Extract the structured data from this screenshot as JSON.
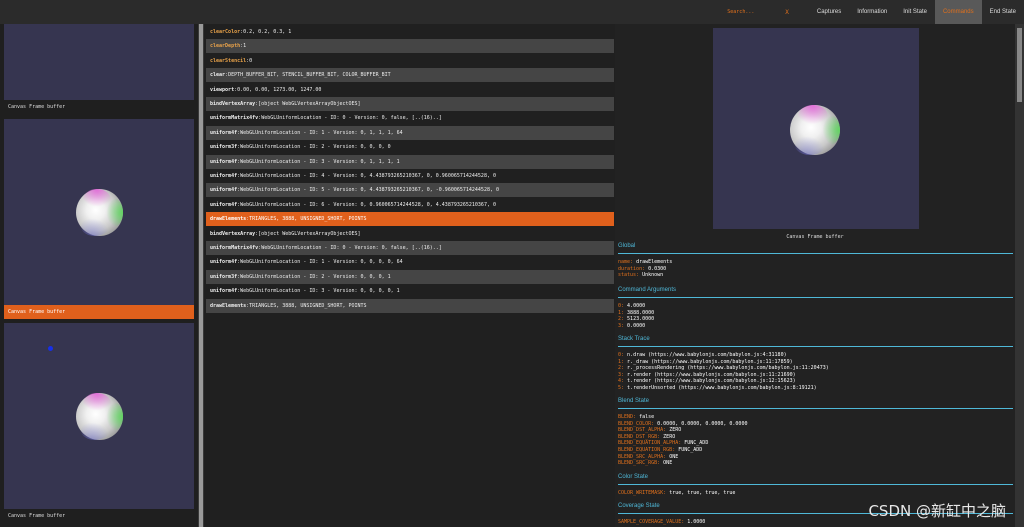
{
  "topbar": {
    "search_placeholder": "Search...",
    "search_clear": "X",
    "tabs": [
      "Captures",
      "Information",
      "Init State",
      "Commands",
      "End State"
    ],
    "active_tab": "Commands"
  },
  "captures": [
    {
      "label": "Canvas Frame buffer"
    },
    {
      "label": "Canvas Frame buffer"
    },
    {
      "label": "Canvas Frame buffer"
    }
  ],
  "commands": [
    {
      "name": "clearColor",
      "args": "0.2, 0.2, 0.3, 1"
    },
    {
      "name": "clearDepth",
      "args": "1"
    },
    {
      "name": "clearStencil",
      "args": "0"
    },
    {
      "name": "clear",
      "args": "DEPTH_BUFFER_BIT, STENCIL_BUFFER_BIT, COLOR_BUFFER_BIT"
    },
    {
      "name": "viewport",
      "args": "0.00, 0.00, 1273.00, 1247.00"
    },
    {
      "name": "bindVertexArray",
      "args": "[object WebGLVertexArrayObjectOES]"
    },
    {
      "name": "uniformMatrix4fv",
      "args": "WebGLUniformLocation - ID: 0 - Version: 0, false, [..(16)..]"
    },
    {
      "name": "uniform4f",
      "args": "WebGLUniformLocation - ID: 1 - Version: 0, 1, 1, 1, 64"
    },
    {
      "name": "uniform3f",
      "args": "WebGLUniformLocation - ID: 2 - Version: 0, 0, 0, 0"
    },
    {
      "name": "uniform4f",
      "args": "WebGLUniformLocation - ID: 3 - Version: 0, 1, 1, 1, 1"
    },
    {
      "name": "uniform4f",
      "args": "WebGLUniformLocation - ID: 4 - Version: 0, 4.438793265210367, 0, 0.960065714244528, 0"
    },
    {
      "name": "uniform4f",
      "args": "WebGLUniformLocation - ID: 5 - Version: 0, 4.438793265210367, 0, -0.960065714244528, 0"
    },
    {
      "name": "uniform4f",
      "args": "WebGLUniformLocation - ID: 6 - Version: 0, 0.960065714244528, 0, 4.438793265210367, 0"
    },
    {
      "name": "drawElements",
      "args": "TRIANGLES, 3888, UNSIGNED_SHORT, POINTS"
    },
    {
      "name": "bindVertexArray",
      "args": "[object WebGLVertexArrayObjectOES]"
    },
    {
      "name": "uniformMatrix4fv",
      "args": "WebGLUniformLocation - ID: 0 - Version: 0, false, [..(16)..]"
    },
    {
      "name": "uniform4f",
      "args": "WebGLUniformLocation - ID: 1 - Version: 0, 0, 0, 0, 64"
    },
    {
      "name": "uniform3f",
      "args": "WebGLUniformLocation - ID: 2 - Version: 0, 0, 0, 1"
    },
    {
      "name": "uniform4f",
      "args": "WebGLUniformLocation - ID: 3 - Version: 0, 0, 0, 0, 1"
    },
    {
      "name": "drawElements",
      "args": "TRIANGLES, 3888, UNSIGNED_SHORT, POINTS"
    }
  ],
  "detail": {
    "caption": "Canvas Frame buffer",
    "global": {
      "title": "Global",
      "rows": [
        {
          "k": "name",
          "v": "drawElements"
        },
        {
          "k": "duration",
          "v": "0.0300"
        },
        {
          "k": "status",
          "v": "Unknown"
        }
      ]
    },
    "command_args": {
      "title": "Command Arguments",
      "rows": [
        {
          "k": "0",
          "v": "4.0000"
        },
        {
          "k": "1",
          "v": "3888.0000"
        },
        {
          "k": "2",
          "v": "5123.0000"
        },
        {
          "k": "3",
          "v": "0.0000"
        }
      ]
    },
    "stack_trace": {
      "title": "Stack Trace",
      "rows": [
        {
          "k": "0",
          "v": "n.draw (https://www.babylonjs.com/babylon.js:4:31180)"
        },
        {
          "k": "1",
          "v": "r._draw (https://www.babylonjs.com/babylon.js:11:17859)"
        },
        {
          "k": "2",
          "v": "r._processRendering (https://www.babylonjs.com/babylon.js:11:20473)"
        },
        {
          "k": "3",
          "v": "r.render (https://www.babylonjs.com/babylon.js:11:21690)"
        },
        {
          "k": "4",
          "v": "t.render (https://www.babylonjs.com/babylon.js:12:15623)"
        },
        {
          "k": "5",
          "v": "t.renderUnsorted (https://www.babylonjs.com/babylon.js:8:19121)"
        }
      ]
    },
    "blend_state": {
      "title": "Blend State",
      "rows": [
        {
          "k": "BLEND",
          "v": "false"
        },
        {
          "k": "BLEND_COLOR",
          "v": "0.0000, 0.0000, 0.0000, 0.0000"
        },
        {
          "k": "BLEND_DST_ALPHA",
          "v": "ZERO"
        },
        {
          "k": "BLEND_DST_RGB",
          "v": "ZERO"
        },
        {
          "k": "BLEND_EQUATION_ALPHA",
          "v": "FUNC_ADD"
        },
        {
          "k": "BLEND_EQUATION_RGB",
          "v": "FUNC_ADD"
        },
        {
          "k": "BLEND_SRC_ALPHA",
          "v": "ONE"
        },
        {
          "k": "BLEND_SRC_RGB",
          "v": "ONE"
        }
      ]
    },
    "color_state": {
      "title": "Color State",
      "rows": [
        {
          "k": "COLOR_WRITEMASK",
          "v": "true, true, true, true"
        }
      ]
    },
    "coverage_state": {
      "title": "Coverage State",
      "rows": [
        {
          "k": "SAMPLE_COVERAGE_VALUE",
          "v": "1.0000"
        }
      ]
    }
  },
  "watermark": "CSDN @新缸中之脑",
  "colors": {
    "accent": "#e0601c",
    "section_head": "#4fb8d8",
    "canvas_bg": "#363550"
  }
}
